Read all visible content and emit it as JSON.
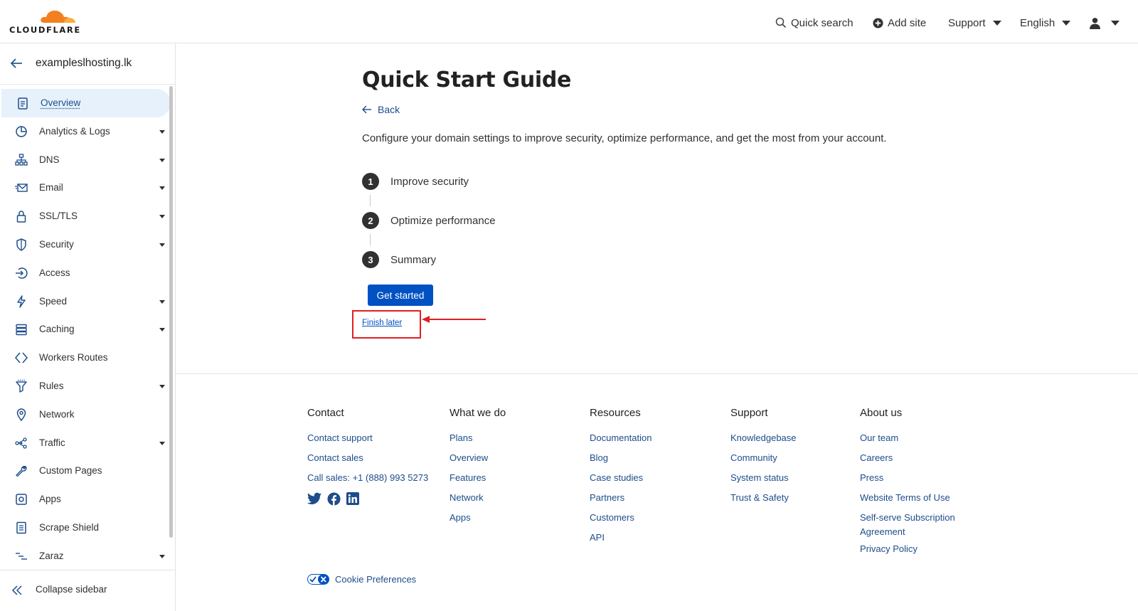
{
  "header": {
    "logo_text": "CLOUDFLARE",
    "quick_search": "Quick search",
    "add_site": "Add site",
    "support": "Support",
    "language": "English"
  },
  "sidebar": {
    "site_name": "exampleslhosting.lk",
    "items": [
      {
        "label": "Overview",
        "icon": "clipboard-icon",
        "has_caret": false,
        "active": true
      },
      {
        "label": "Analytics & Logs",
        "icon": "pie-chart-icon",
        "has_caret": true
      },
      {
        "label": "DNS",
        "icon": "network-tree-icon",
        "has_caret": true
      },
      {
        "label": "Email",
        "icon": "envelope-icon",
        "has_caret": true
      },
      {
        "label": "SSL/TLS",
        "icon": "lock-icon",
        "has_caret": true
      },
      {
        "label": "Security",
        "icon": "shield-icon",
        "has_caret": true
      },
      {
        "label": "Access",
        "icon": "access-icon",
        "has_caret": false
      },
      {
        "label": "Speed",
        "icon": "lightning-icon",
        "has_caret": true
      },
      {
        "label": "Caching",
        "icon": "server-icon",
        "has_caret": true
      },
      {
        "label": "Workers Routes",
        "icon": "code-brackets-icon",
        "has_caret": false
      },
      {
        "label": "Rules",
        "icon": "funnel-icon",
        "has_caret": true
      },
      {
        "label": "Network",
        "icon": "location-pin-icon",
        "has_caret": false
      },
      {
        "label": "Traffic",
        "icon": "traffic-icon",
        "has_caret": true
      },
      {
        "label": "Custom Pages",
        "icon": "wrench-icon",
        "has_caret": false
      },
      {
        "label": "Apps",
        "icon": "apps-icon",
        "has_caret": false
      },
      {
        "label": "Scrape Shield",
        "icon": "document-icon",
        "has_caret": false
      },
      {
        "label": "Zaraz",
        "icon": "zaraz-icon",
        "has_caret": true
      }
    ],
    "collapse_label": "Collapse sidebar"
  },
  "main": {
    "title": "Quick Start Guide",
    "back_label": "Back",
    "description": "Configure your domain settings to improve security, optimize performance, and get the most from your account.",
    "steps": [
      {
        "num": "1",
        "label": "Improve security"
      },
      {
        "num": "2",
        "label": "Optimize performance"
      },
      {
        "num": "3",
        "label": "Summary"
      }
    ],
    "get_started": "Get started",
    "finish_later": "Finish later"
  },
  "footer": {
    "columns": [
      {
        "heading": "Contact",
        "links": [
          "Contact support",
          "Contact sales",
          "Call sales: +1 (888) 993 5273"
        ]
      },
      {
        "heading": "What we do",
        "links": [
          "Plans",
          "Overview",
          "Features",
          "Network",
          "Apps"
        ]
      },
      {
        "heading": "Resources",
        "links": [
          "Documentation",
          "Blog",
          "Case studies",
          "Partners",
          "Customers",
          "API"
        ]
      },
      {
        "heading": "Support",
        "links": [
          "Knowledgebase",
          "Community",
          "System status",
          "Trust & Safety"
        ]
      },
      {
        "heading": "About us",
        "links": [
          "Our team",
          "Careers",
          "Press",
          "Website Terms of Use",
          "Self-serve Subscription Agreement",
          "Privacy Policy"
        ]
      }
    ],
    "cookie_preferences": "Cookie Preferences"
  },
  "colors": {
    "brand_orange": "#f38020",
    "primary_blue": "#0051c3",
    "link_blue": "#1d4d8a",
    "highlight_red": "#e02020"
  }
}
